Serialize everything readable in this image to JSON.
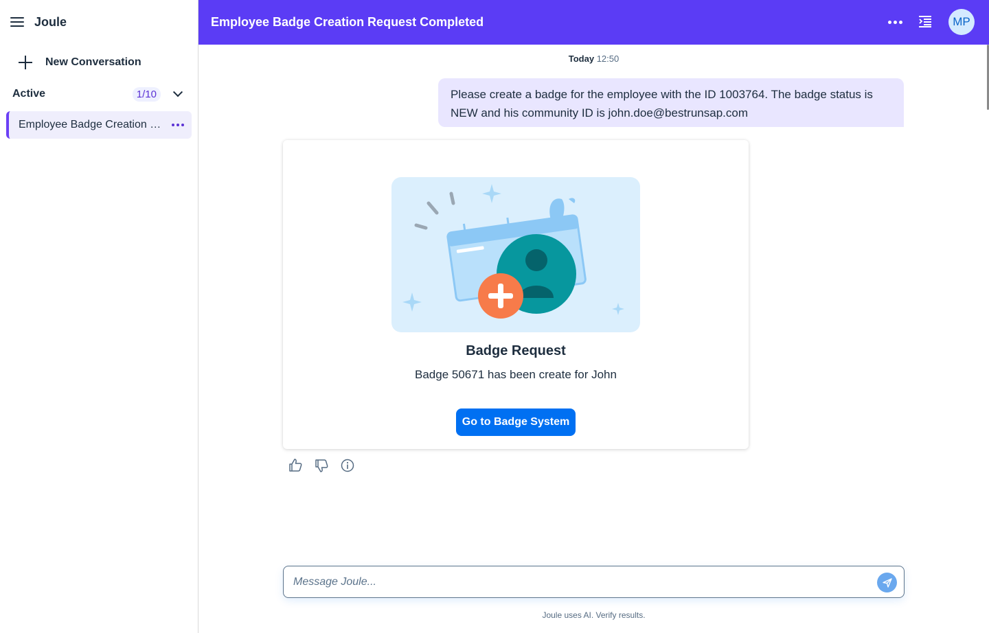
{
  "sidebar": {
    "app_name": "Joule",
    "new_conversation_label": "New Conversation",
    "section_label": "Active",
    "section_count": "1/10",
    "conversations": [
      {
        "label": "Employee Badge Creation Request Completed"
      }
    ]
  },
  "header": {
    "title": "Employee Badge Creation Request Completed",
    "avatar_initials": "MP",
    "colors": {
      "bar": "#5b3cf5",
      "avatar_bg": "#d4eaff"
    }
  },
  "chat": {
    "date_label": "Today",
    "time_label": "12:50",
    "user_message": "Please create a badge for the employee with the ID 1003764. The badge status is NEW and his community ID is john.doe@bestrunsap.com",
    "card": {
      "title": "Badge Request",
      "text": "Badge 50671 has been create for John",
      "button_label": "Go to Badge System"
    },
    "feedback_icons": [
      "thumbs-up-icon",
      "thumbs-down-icon",
      "info-icon"
    ]
  },
  "composer": {
    "placeholder": "Message Joule...",
    "disclaimer": "Joule uses AI. Verify results."
  }
}
